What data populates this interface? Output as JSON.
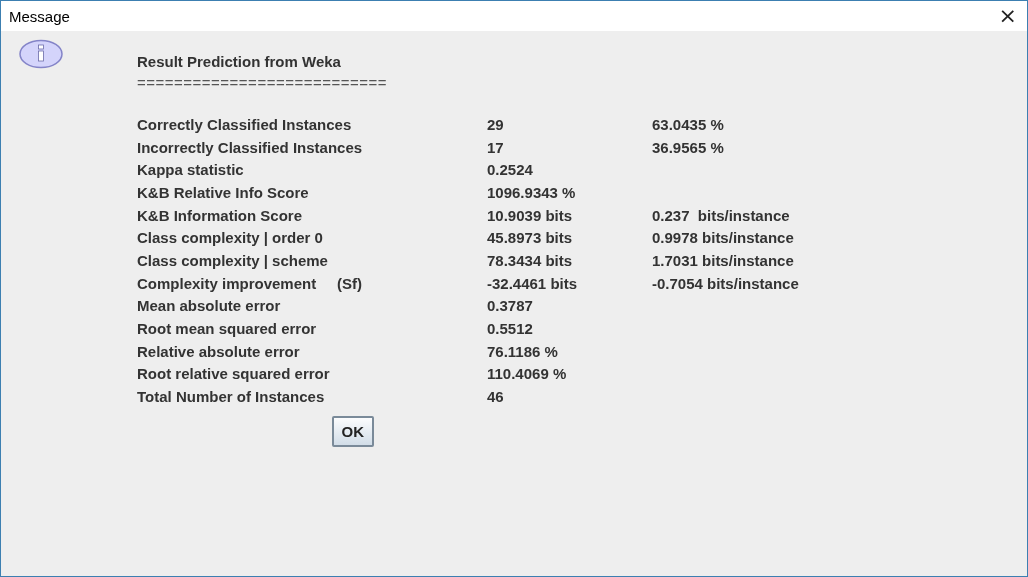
{
  "window": {
    "title": "Message",
    "close": "×"
  },
  "message": {
    "heading": "Result Prediction from Weka",
    "rule": "===========================",
    "rows": [
      {
        "label": "Correctly Classified Instances",
        "values": [
          "29",
          "63.0435 %"
        ]
      },
      {
        "label": "Incorrectly Classified Instances",
        "values": [
          "17",
          "36.9565 %"
        ]
      },
      {
        "label": "Kappa statistic",
        "values": [
          "0.2524"
        ]
      },
      {
        "label": "K&B Relative Info Score",
        "values": [
          "1096.9343 %"
        ]
      },
      {
        "label": "K&B Information Score",
        "values": [
          "10.9039 bits",
          "0.237  bits/instance"
        ]
      },
      {
        "label": "Class complexity | order 0",
        "values": [
          "45.8973 bits",
          "0.9978 bits/instance"
        ]
      },
      {
        "label": "Class complexity | scheme",
        "values": [
          "78.3434 bits",
          "1.7031 bits/instance"
        ]
      },
      {
        "label": "Complexity improvement     (Sf)",
        "values": [
          "-32.4461 bits",
          "-0.7054 bits/instance"
        ]
      },
      {
        "label": "Mean absolute error",
        "values": [
          "0.3787"
        ]
      },
      {
        "label": "Root mean squared error",
        "values": [
          "0.5512"
        ]
      },
      {
        "label": "Relative absolute error",
        "values": [
          "76.1186 %"
        ]
      },
      {
        "label": "Root relative squared error",
        "values": [
          "110.4069 %"
        ]
      },
      {
        "label": "Total Number of Instances",
        "values": [
          "46"
        ]
      }
    ]
  },
  "buttons": [
    "OK"
  ]
}
